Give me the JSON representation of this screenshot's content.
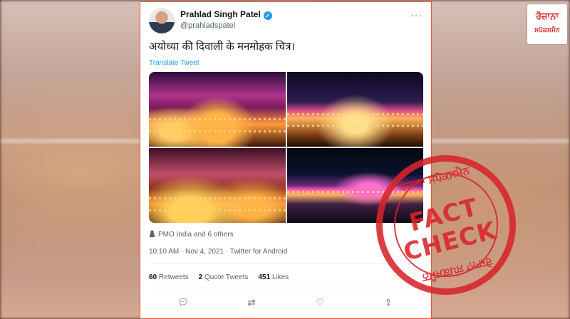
{
  "tweet": {
    "author_name": "Prahlad Singh Patel",
    "handle": "@prahladspatel",
    "text": "अयोध्या की दिवाली के मनमोहक चित्र।",
    "translate_label": "Translate Tweet",
    "tagged_people": "PMO India and 6 others",
    "timestamp": "10:10 AM · Nov 4, 2021 · Twitter for Android",
    "stats": {
      "retweets_count": "60",
      "retweets_label": "Retweets",
      "quotes_count": "2",
      "quotes_label": "Quote Tweets",
      "likes_count": "451",
      "likes_label": "Likes"
    },
    "more_glyph": "···",
    "verified_glyph": "✓",
    "action_icons": {
      "reply": "💬︎",
      "retweet": "⇄",
      "like": "♡",
      "share": "⇪"
    }
  },
  "stamp": {
    "top_text": "ਰੋਜ਼ਾਨਾ ਸਪੋਕਸਮੈਨ",
    "bottom_text": "ਰੋਜ਼ਾਨਾ ਸਪੋਕਸਮੈਨ",
    "line1": "FACT",
    "line2": "CHECK",
    "color": "#d8252a"
  },
  "logo": {
    "line1": "ਰੋਜ਼ਾਨਾ",
    "line2": "ਸਪੋਕਸਮੈਨ",
    "color": "#d8252a"
  },
  "colors": {
    "link": "#1d9bf0",
    "muted": "#536471",
    "tweet_border": "#e3573b"
  }
}
